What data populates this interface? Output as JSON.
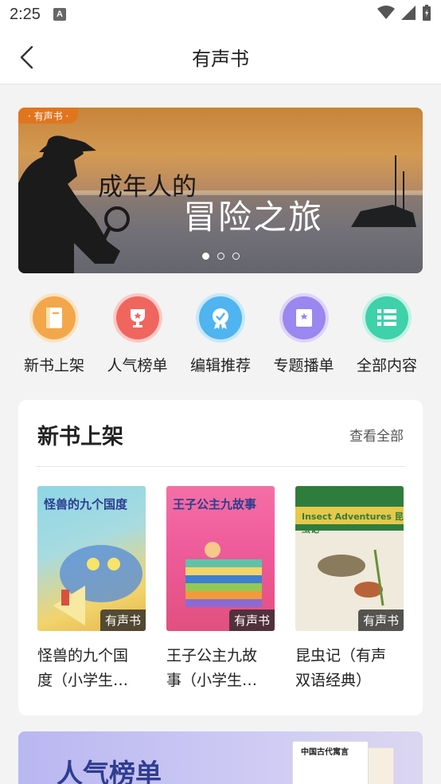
{
  "status": {
    "time": "2:25"
  },
  "nav": {
    "title": "有声书"
  },
  "banner": {
    "tag": "· 有声书 ·",
    "line1": "成年人的",
    "line2": "冒险之旅",
    "dots": 3,
    "active_dot": 0
  },
  "categories": [
    {
      "label": "新书上架",
      "icon": "book-icon",
      "color": "#f3a74a"
    },
    {
      "label": "人气榜单",
      "icon": "trophy-icon",
      "color": "#f1655f"
    },
    {
      "label": "编辑推荐",
      "icon": "medal-icon",
      "color": "#4fb4ef"
    },
    {
      "label": "专题播单",
      "icon": "bookmark-icon",
      "color": "#9a87ef"
    },
    {
      "label": "全部内容",
      "icon": "list-icon",
      "color": "#3fd1a9"
    }
  ],
  "new_books": {
    "title": "新书上架",
    "more": "查看全部",
    "items": [
      {
        "cover_title": "怪兽的九个国度",
        "badge": "有声书",
        "title_lines": [
          "怪兽的九个国",
          "度（小学生…"
        ]
      },
      {
        "cover_title": "王子公主九故事",
        "badge": "有声书",
        "title_lines": [
          "王子公主九故",
          "事（小学生…"
        ]
      },
      {
        "cover_title": "Insect Adventures 昆虫记",
        "badge": "有声书",
        "title_lines": [
          "昆虫记（有声",
          "双语经典）"
        ]
      }
    ]
  },
  "popular": {
    "title": "人气榜单",
    "book_title": "中国古代寓言"
  }
}
